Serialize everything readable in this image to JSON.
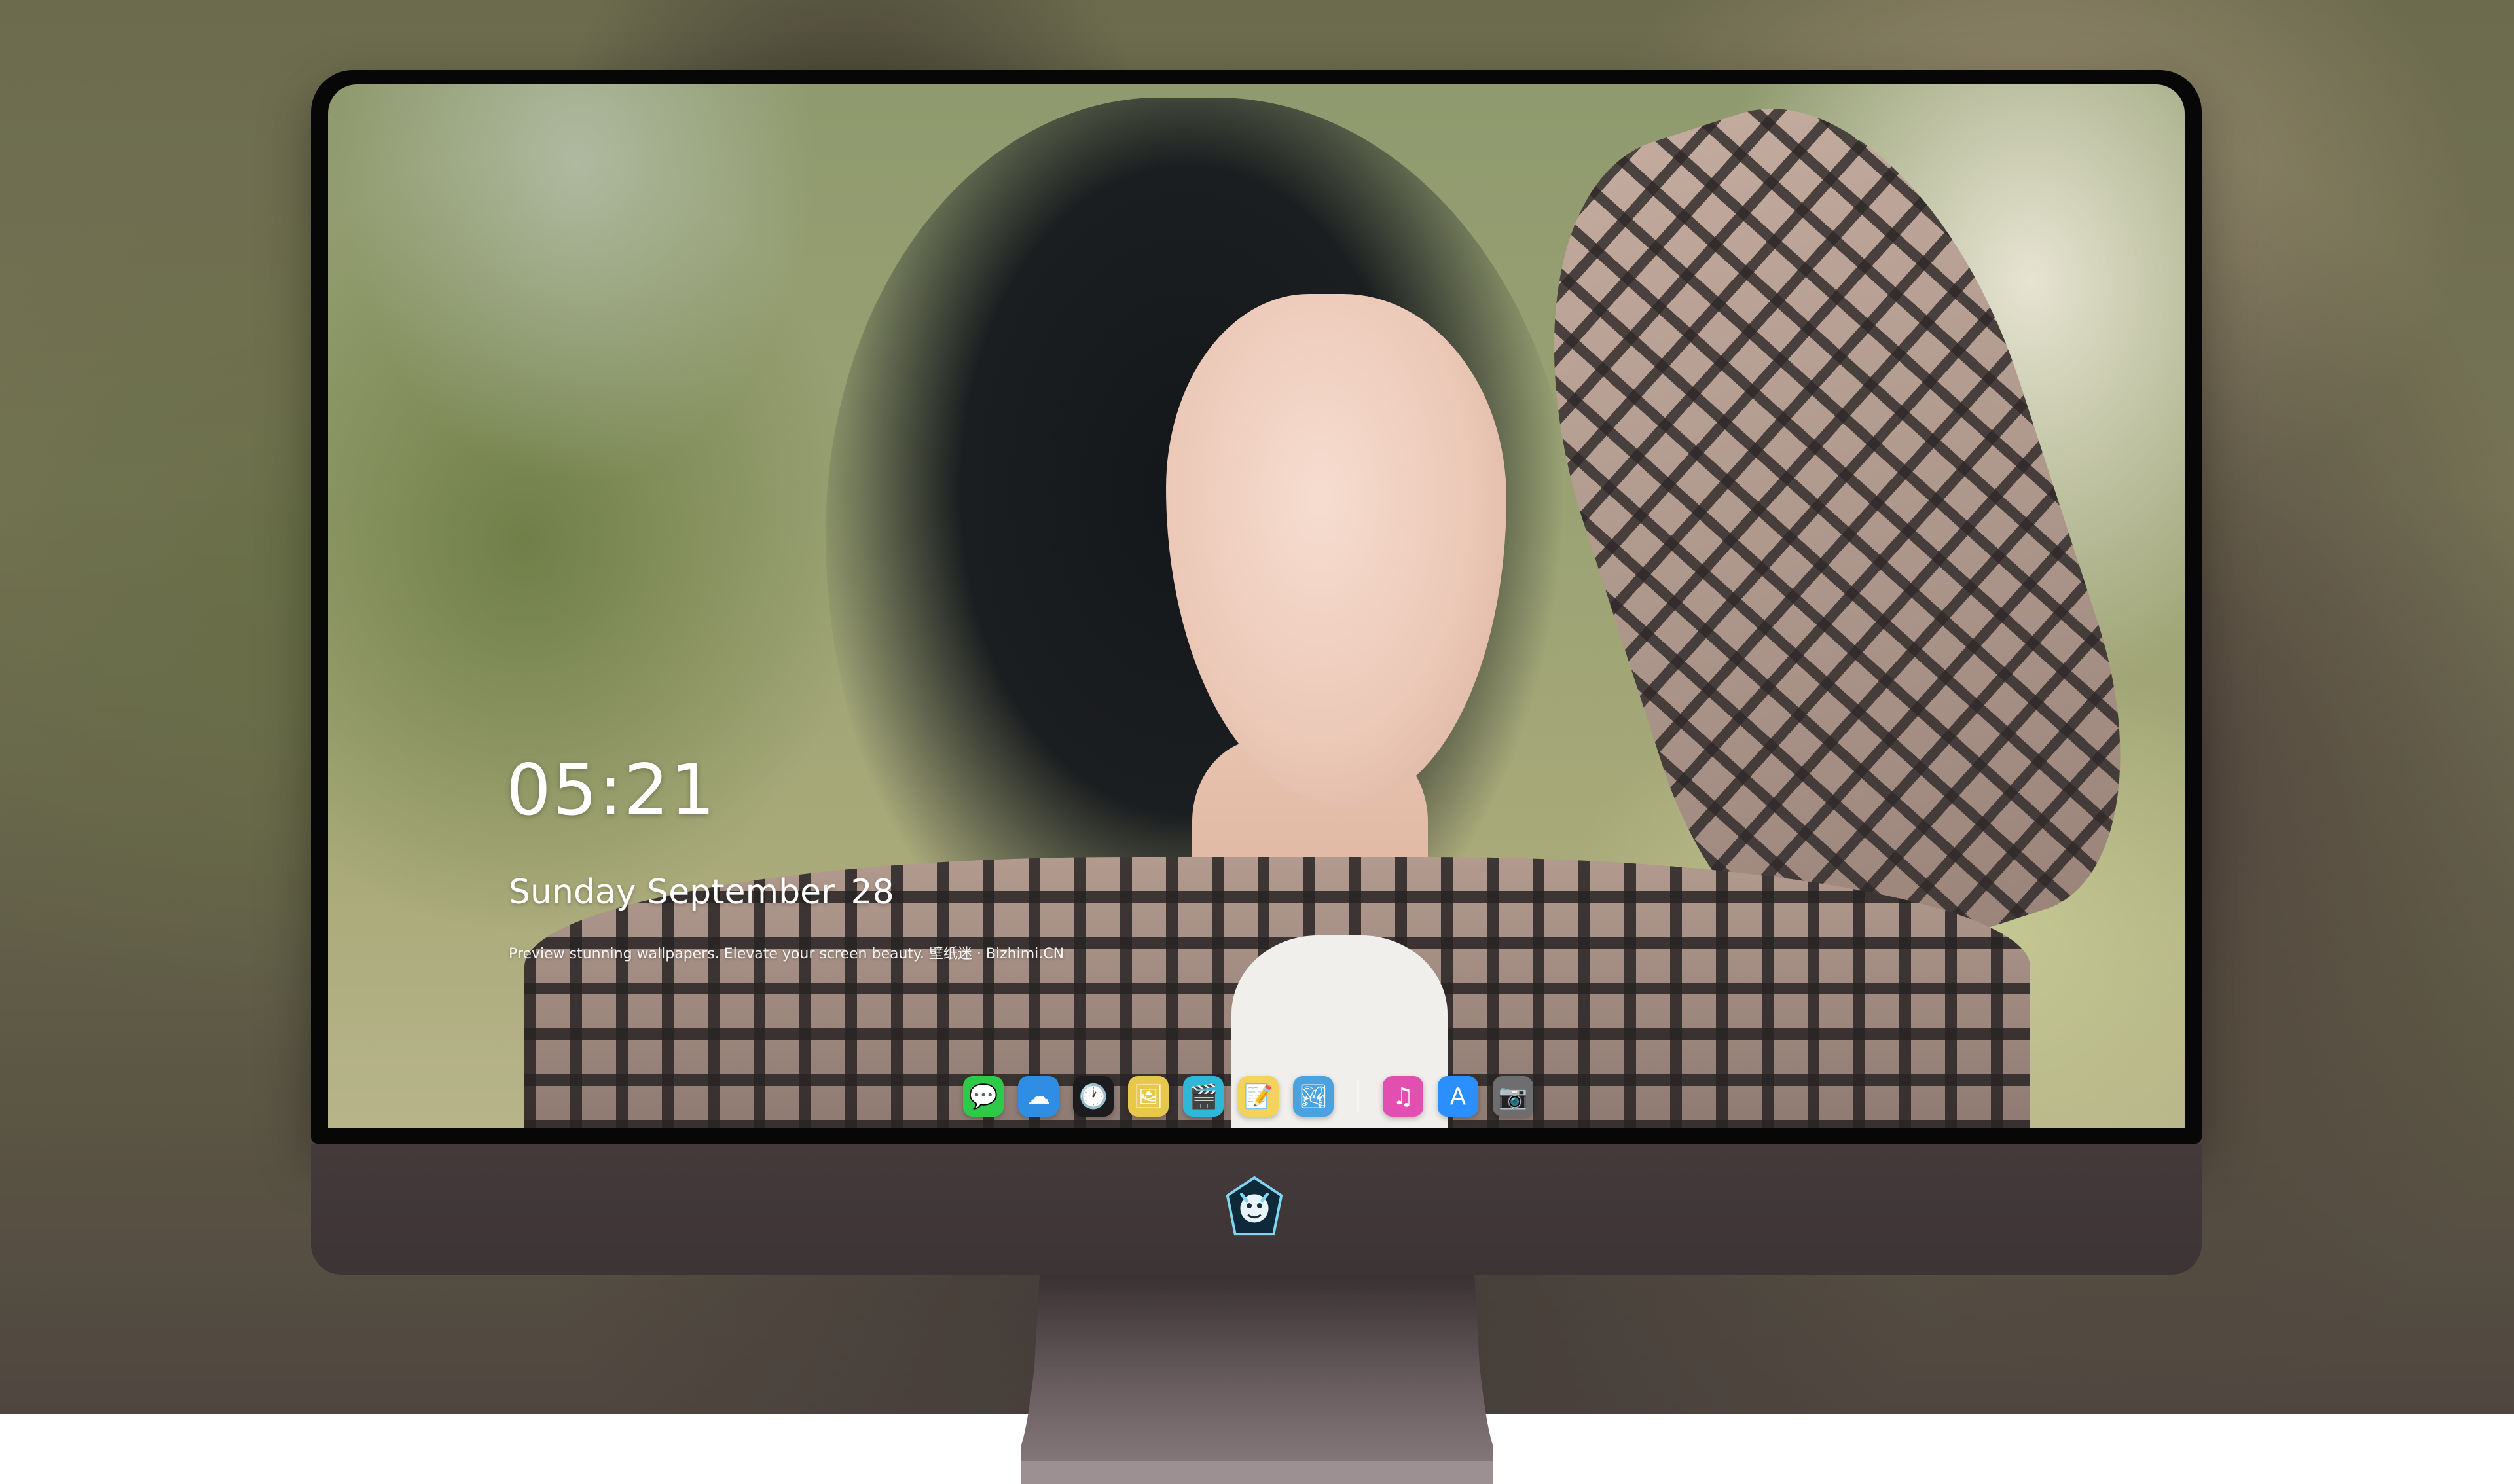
{
  "lock_screen": {
    "time": "05:21",
    "weekday_month": "Sunday September",
    "day": "28",
    "tagline": "Preview stunning wallpapers. Elevate your screen beauty. 壁纸迷 · Bizhimi.CN"
  },
  "dock": {
    "apps": [
      {
        "name": "messages-icon",
        "glyph": "💬",
        "color": "#2fc94a"
      },
      {
        "name": "weather-icon",
        "glyph": "☁",
        "color": "#2f8de4"
      },
      {
        "name": "clock-icon",
        "glyph": "🕐",
        "color": "#1c1c1e"
      },
      {
        "name": "preview-icon",
        "glyph": "🖼",
        "color": "#e7c84a"
      },
      {
        "name": "video-editor-icon",
        "glyph": "🎬",
        "color": "#2fb8d6"
      },
      {
        "name": "notes-icon",
        "glyph": "📝",
        "color": "#f5d35a"
      },
      {
        "name": "photos-icon",
        "glyph": "🏞",
        "color": "#4aa3e0"
      },
      {
        "name": "music-icon",
        "glyph": "♫",
        "color": "#e24fb0"
      },
      {
        "name": "app-store-icon",
        "glyph": "A",
        "color": "#2b8fff"
      },
      {
        "name": "camera-icon",
        "glyph": "📷",
        "color": "#6e6e70"
      }
    ]
  },
  "colors": {
    "bezel": "#070707",
    "chin": "#443a3b",
    "stand": "#5e5356",
    "text": "#ffffff"
  }
}
